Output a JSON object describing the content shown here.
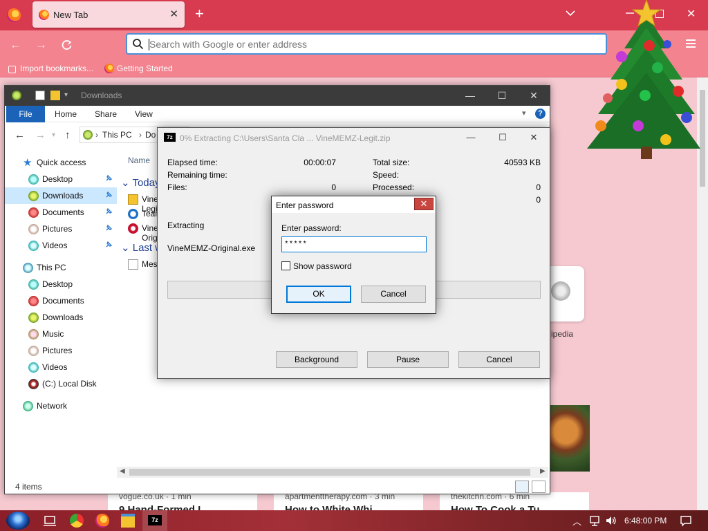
{
  "firefox": {
    "tab_title": "New Tab",
    "tab_close": "✕",
    "new_tab": "+",
    "url_placeholder": "Search with Google or enter address",
    "url_value": "",
    "bookmarks": [
      {
        "label": "Import bookmarks..."
      },
      {
        "label": "Getting Started"
      }
    ],
    "site_tile_label": "ipedia",
    "cards": [
      {
        "source": "vogue.co.uk · 1 min",
        "title": "9 Hand-Formed I"
      },
      {
        "source": "apartmenttherapy.com · 3 min",
        "title": "How to White Whi"
      },
      {
        "source": "thekitchn.com · 6 min",
        "title": "How To Cook a Tu"
      }
    ]
  },
  "explorer": {
    "title": "Downloads",
    "ribbon_tabs": [
      "File",
      "Home",
      "Share",
      "View"
    ],
    "help": "?",
    "breadcrumb": [
      "This PC",
      "Do"
    ],
    "column_name": "Name",
    "groups": [
      {
        "label": "Today",
        "files": [
          "VineMEMZ-Legit.zip",
          "TeamViewer_Setup.exe",
          "VineMEMZ-Original.exe"
        ]
      },
      {
        "label": "Last week",
        "files": [
          "Messages.txt"
        ]
      }
    ],
    "nav": {
      "quick_access": "Quick access",
      "quick_items": [
        "Desktop",
        "Downloads",
        "Documents",
        "Pictures",
        "Videos"
      ],
      "this_pc": "This PC",
      "pc_items": [
        "Desktop",
        "Documents",
        "Downloads",
        "Music",
        "Pictures",
        "Videos",
        "(C:) Local Disk"
      ],
      "network": "Network"
    },
    "status": "4 items"
  },
  "zip": {
    "icon_text": "7z",
    "title": "0% Extracting C:\\Users\\Santa Cla ... VineMEMZ-Legit.zip",
    "elapsed_label": "Elapsed time:",
    "elapsed_value": "00:00:07",
    "remaining_label": "Remaining time:",
    "files_label": "Files:",
    "files_value": "0",
    "total_size_label": "Total size:",
    "total_size_value": "40593 KB",
    "speed_label": "Speed:",
    "processed_label": "Processed:",
    "processed_value": "0",
    "extra_value": "0",
    "status": "Extracting",
    "current_file": "VineMEMZ-Original.exe",
    "progress": 0,
    "buttons": {
      "background": "Background",
      "pause": "Pause",
      "cancel": "Cancel"
    }
  },
  "password_dialog": {
    "title": "Enter password",
    "close": "✕",
    "label": "Enter password:",
    "value": "*****",
    "show_password_label": "Show password",
    "show_password_checked": false,
    "ok": "OK",
    "cancel": "Cancel"
  },
  "taskbar": {
    "clock": "6:48:00 PM"
  },
  "colors": {
    "firefox_accent": "#d83b4f",
    "explorer_blue": "#1a63b8",
    "default_button_border": "#0078d7"
  }
}
